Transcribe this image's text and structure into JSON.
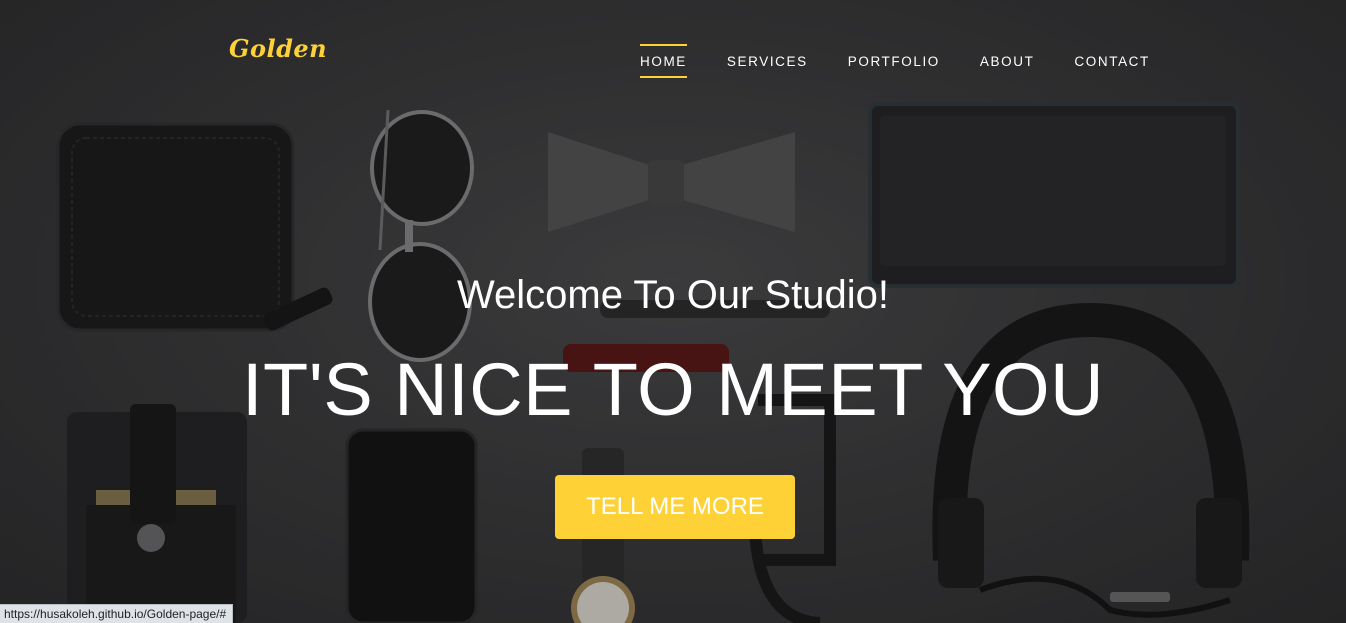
{
  "brand": {
    "label": "Golden",
    "color": "#fed136"
  },
  "nav": {
    "items": [
      {
        "label": "HOME",
        "active": true
      },
      {
        "label": "SERVICES",
        "active": false
      },
      {
        "label": "PORTFOLIO",
        "active": false
      },
      {
        "label": "ABOUT",
        "active": false
      },
      {
        "label": "CONTACT",
        "active": false
      }
    ],
    "active_color": "#fed136"
  },
  "hero": {
    "lead_in": "Welcome To Our Studio!",
    "heading": "IT'S NICE TO MEET YOU",
    "cta_label": "TELL ME MORE",
    "cta_color": "#fed136"
  },
  "status_bar": {
    "url": "https://husakoleh.github.io/Golden-page/#"
  }
}
